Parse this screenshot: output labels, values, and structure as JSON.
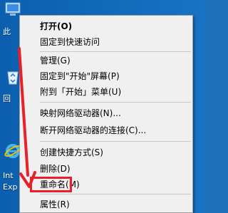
{
  "desktop": {
    "icons": [
      {
        "name": "this-pc",
        "label": "此"
      },
      {
        "name": "recycle-bin",
        "label": "回"
      },
      {
        "name": "internet-explorer",
        "label_line1": "Int",
        "label_line2": "Exp"
      }
    ]
  },
  "context_menu": {
    "items": [
      {
        "label": "打开(O)"
      },
      {
        "label": "固定到快速访问"
      },
      {
        "label": "管理(G)"
      },
      {
        "label": "固定到\"开始\"屏幕(P)"
      },
      {
        "label": "附到「开始」菜单(U)"
      },
      {
        "label": "映射网络驱动器(N)..."
      },
      {
        "label": "断开网络驱动器的连接(C)..."
      },
      {
        "label": "创建快捷方式(S)"
      },
      {
        "label": "删除(D)"
      },
      {
        "label": "重命名(M)"
      },
      {
        "label": "属性(R)"
      }
    ]
  },
  "colors": {
    "annotation": "#e8202a",
    "menu_bg": "#f0f0f0",
    "desktop_bg": "#1873c4"
  }
}
